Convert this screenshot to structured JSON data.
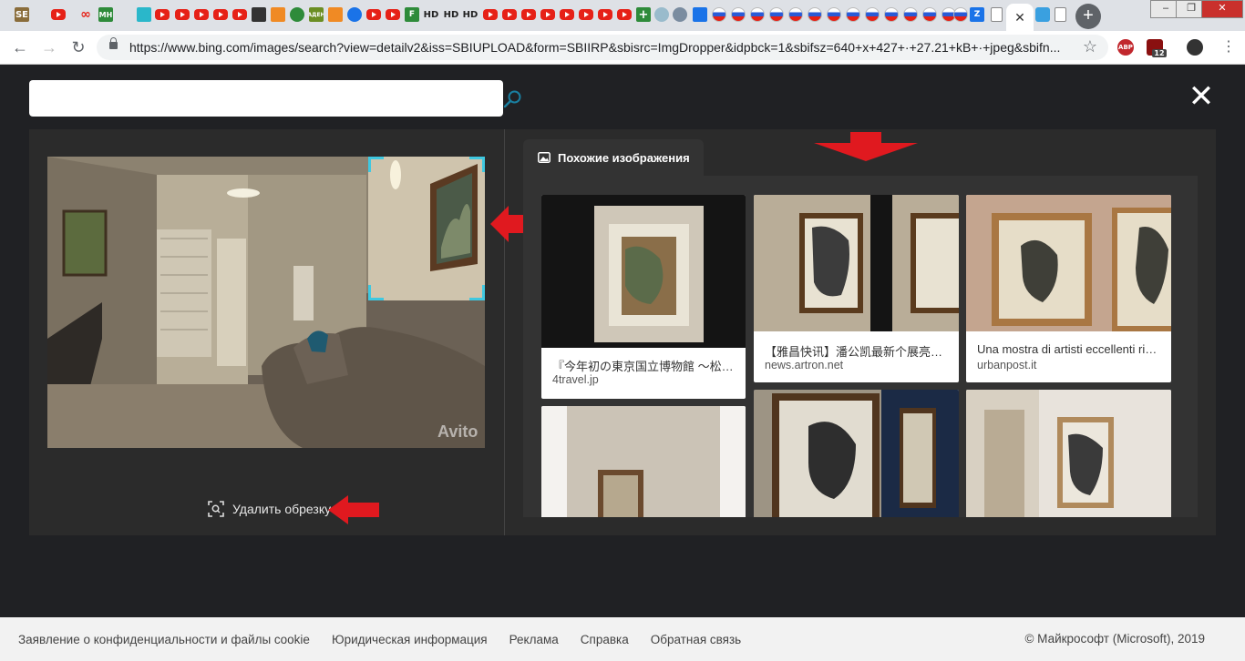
{
  "browser": {
    "url": "https://www.bing.com/images/search?view=detailv2&iss=SBIUPLOAD&form=SBIIRP&sbisrc=ImgDropper&idpbck=1&sbifsz=640+x+427+·+27.21+kB+·+jpeg&sbifn...",
    "tab_badges": {
      "se": "SE",
      "mh": "MH",
      "hd": "HD",
      "aden": "АДЕН",
      "z": "Z",
      "f": "F"
    },
    "active_tab_close": "✕",
    "new_tab": "+",
    "ext_abp": "ABP",
    "ext_count": "12"
  },
  "search": {
    "placeholder": "",
    "value": ""
  },
  "close_label": "✕",
  "crop": {
    "remove_label": "Удалить обрезку"
  },
  "source_image": {
    "watermark": "Avito"
  },
  "similar": {
    "tab_label": "Похожие изображения",
    "results": [
      {
        "caption": "『今年初の東京国立博物館 ～松…",
        "source": "4travel.jp"
      },
      {
        "caption": "【雅昌快讯】潘公凯最新个展亮…",
        "source": "news.artron.net"
      },
      {
        "caption": "Una mostra di artisti eccellenti ri…",
        "source": "urbanpost.it"
      },
      {
        "caption": "",
        "source": ""
      },
      {
        "caption": "",
        "source": ""
      },
      {
        "caption": "",
        "source": ""
      }
    ]
  },
  "footer": {
    "links": [
      "Заявление о конфиденциальности и файлы cookie",
      "Юридическая информация",
      "Реклама",
      "Справка",
      "Обратная связь"
    ],
    "copyright": "© Майкрософт (Microsoft), 2019"
  },
  "colors": {
    "accent": "#3fc8e0",
    "annotation_arrow": "#e0191f",
    "page_bg": "#202124",
    "panel_bg": "#2b2b2b"
  }
}
